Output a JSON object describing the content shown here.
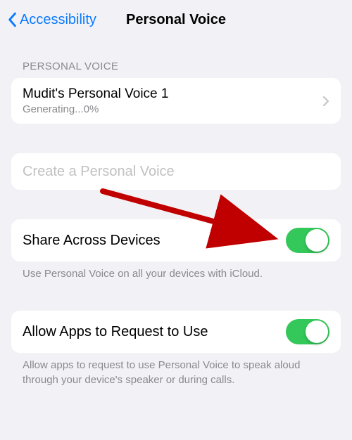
{
  "nav": {
    "back_label": "Accessibility",
    "title": "Personal Voice"
  },
  "section1": {
    "header": "PERSONAL VOICE",
    "voice_name": "Mudit's Personal Voice 1",
    "voice_status": "Generating...0%"
  },
  "create": {
    "label": "Create a Personal Voice"
  },
  "share": {
    "label": "Share Across Devices",
    "enabled": true,
    "footer": "Use Personal Voice on all your devices with iCloud."
  },
  "allow": {
    "label": "Allow Apps to Request to Use",
    "enabled": true,
    "footer": "Allow apps to request to use Personal Voice to speak aloud through your device's speaker or during calls."
  },
  "colors": {
    "accent": "#0a7aff",
    "toggle_on": "#34c759",
    "arrow": "#c00000"
  }
}
